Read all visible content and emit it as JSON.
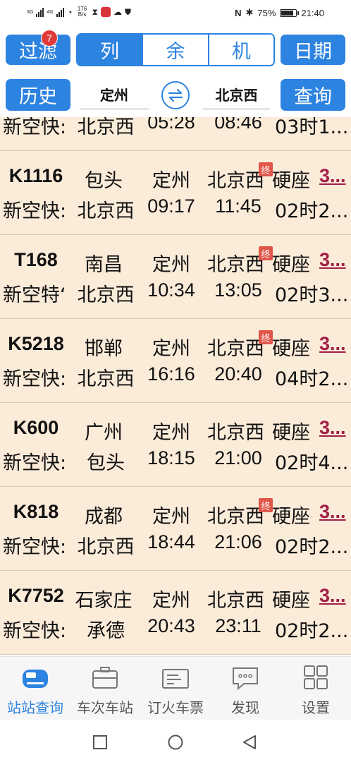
{
  "status_bar": {
    "signal_1": "3G",
    "signal_2": "4G",
    "net_speed": "176",
    "net_unit": "B/s",
    "nfc": "N",
    "bluetooth": "✱",
    "battery_percent": "75%",
    "battery_level": 0.75,
    "time": "21:40"
  },
  "toolbar": {
    "filter_label": "过滤",
    "filter_badge": "7",
    "seg_train": "列",
    "seg_remaining": "余",
    "seg_machine": "机",
    "date_label": "日期",
    "history_label": "历史",
    "from_station": "定州",
    "to_station": "北京西",
    "query_label": "查询",
    "swap_icon": "swap-arrows-icon"
  },
  "trains": [
    {
      "train_no": "",
      "origin": "",
      "from": "",
      "to": "",
      "seat": "",
      "price": "",
      "type": "新空快:",
      "terminal": "北京西",
      "depart": "05:28",
      "arrive": "08:46",
      "duration": "03时1...",
      "zhong": false
    },
    {
      "train_no": "K1116",
      "origin": "包头",
      "from": "定州",
      "to": "北京西",
      "seat": "硬座",
      "price": "3...",
      "type": "新空快:",
      "terminal": "北京西",
      "depart": "09:17",
      "arrive": "11:45",
      "duration": "02时2...",
      "zhong": true
    },
    {
      "train_no": "T168",
      "origin": "南昌",
      "from": "定州",
      "to": "北京西",
      "seat": "硬座",
      "price": "3...",
      "type": "新空特‘",
      "terminal": "北京西",
      "depart": "10:34",
      "arrive": "13:05",
      "duration": "02时3...",
      "zhong": true
    },
    {
      "train_no": "K5218",
      "origin": "邯郸",
      "from": "定州",
      "to": "北京西",
      "seat": "硬座",
      "price": "3...",
      "type": "新空快:",
      "terminal": "北京西",
      "depart": "16:16",
      "arrive": "20:40",
      "duration": "04时2...",
      "zhong": true
    },
    {
      "train_no": "K600",
      "origin": "广州",
      "from": "定州",
      "to": "北京西",
      "seat": "硬座",
      "price": "3...",
      "type": "新空快:",
      "terminal": "包头",
      "depart": "18:15",
      "arrive": "21:00",
      "duration": "02时4...",
      "zhong": false
    },
    {
      "train_no": "K818",
      "origin": "成都",
      "from": "定州",
      "to": "北京西",
      "seat": "硬座",
      "price": "3...",
      "type": "新空快:",
      "terminal": "北京西",
      "depart": "18:44",
      "arrive": "21:06",
      "duration": "02时2...",
      "zhong": true
    },
    {
      "train_no": "K7752",
      "origin": "石家庄",
      "from": "定州",
      "to": "北京西",
      "seat": "硬座",
      "price": "3...",
      "type": "新空快:",
      "terminal": "承德",
      "depart": "20:43",
      "arrive": "23:11",
      "duration": "02时2...",
      "zhong": false
    }
  ],
  "terminal_mark": "终",
  "bottom_nav": [
    {
      "label": "站站查询",
      "icon": "train-icon",
      "active": true
    },
    {
      "label": "车次车站",
      "icon": "briefcase-icon",
      "active": false
    },
    {
      "label": "订火车票",
      "icon": "ticket-icon",
      "active": false
    },
    {
      "label": "发现",
      "icon": "chat-bubble-icon",
      "active": false
    },
    {
      "label": "设置",
      "icon": "grid-icon",
      "active": false
    }
  ],
  "colors": {
    "accent": "#2d83e0",
    "row_bg": "#fbebd9",
    "price": "#a11f46",
    "terminal_badge": "#e0574a"
  }
}
